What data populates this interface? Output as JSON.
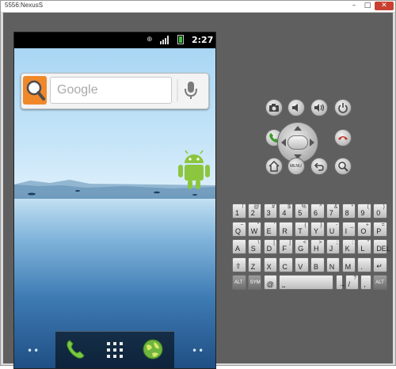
{
  "window": {
    "title": "5556:NexusS",
    "minimize": "–",
    "maximize": "□",
    "close": "✕"
  },
  "status_bar": {
    "time": "2:27",
    "usb": "⊕",
    "icons": [
      "usb-icon",
      "signal-icon",
      "battery-icon"
    ]
  },
  "search_widget": {
    "placeholder": "Google",
    "search_icon": "search-icon",
    "mic_icon": "microphone-icon"
  },
  "home": {
    "widget_icon": "android-robot-icon"
  },
  "dock": {
    "left_indicator": "••",
    "right_indicator": "••",
    "items": [
      "phone-icon",
      "app-drawer-icon",
      "browser-icon"
    ]
  },
  "hardware_buttons": {
    "row1": [
      "camera-icon",
      "volume-down-icon",
      "volume-up-icon",
      "power-icon"
    ],
    "row2": [
      "call-icon",
      "dpad",
      "end-call-icon"
    ],
    "row3": [
      "home-icon",
      "menu-button",
      "back-icon",
      "search-icon"
    ],
    "menu_label": "MENU"
  },
  "keyboard": {
    "rows": [
      [
        {
          "k": "1",
          "s": "!"
        },
        {
          "k": "2",
          "s": "@"
        },
        {
          "k": "3",
          "s": "#"
        },
        {
          "k": "4",
          "s": "$"
        },
        {
          "k": "5",
          "s": "%"
        },
        {
          "k": "6",
          "s": "^"
        },
        {
          "k": "7",
          "s": "&"
        },
        {
          "k": "8",
          "s": "*"
        },
        {
          "k": "9",
          "s": "("
        },
        {
          "k": "0",
          "s": ")"
        }
      ],
      [
        {
          "k": "Q",
          "s": "~"
        },
        {
          "k": "W",
          "s": "\""
        },
        {
          "k": "E",
          "s": "'"
        },
        {
          "k": "R",
          "s": ""
        },
        {
          "k": "T",
          "s": "{"
        },
        {
          "k": "Y",
          "s": "}"
        },
        {
          "k": "U",
          "s": "-"
        },
        {
          "k": "I",
          "s": "_"
        },
        {
          "k": "O",
          "s": "+"
        },
        {
          "k": "P",
          "s": "="
        }
      ],
      [
        {
          "k": "A",
          "s": ""
        },
        {
          "k": "S",
          "s": "\\"
        },
        {
          "k": "D",
          "s": "["
        },
        {
          "k": "F",
          "s": "]"
        },
        {
          "k": "G",
          "s": "<"
        },
        {
          "k": "H",
          "s": ">"
        },
        {
          "k": "J",
          "s": ";"
        },
        {
          "k": "K",
          "s": ":"
        },
        {
          "k": "L",
          "s": "\""
        },
        {
          "k": "DEL",
          "s": ""
        }
      ],
      [
        {
          "k": "⇧",
          "s": ""
        },
        {
          "k": "Z",
          "s": ""
        },
        {
          "k": "X",
          "s": ""
        },
        {
          "k": "C",
          "s": ""
        },
        {
          "k": "V",
          "s": ""
        },
        {
          "k": "B",
          "s": ""
        },
        {
          "k": "N",
          "s": ""
        },
        {
          "k": "M",
          "s": ""
        },
        {
          "k": ".",
          "s": ""
        },
        {
          "k": "↵",
          "s": ""
        }
      ],
      [
        {
          "k": "ALT",
          "s": ""
        },
        {
          "k": "SYM",
          "s": ""
        },
        {
          "k": "@",
          "s": ""
        },
        {
          "k": "⎵",
          "s": ""
        },
        {
          "k": "→",
          "s": ""
        },
        {
          "k": "/",
          "s": "?"
        },
        {
          "k": ",",
          "s": ""
        },
        {
          "k": "ALT",
          "s": ""
        }
      ]
    ]
  }
}
